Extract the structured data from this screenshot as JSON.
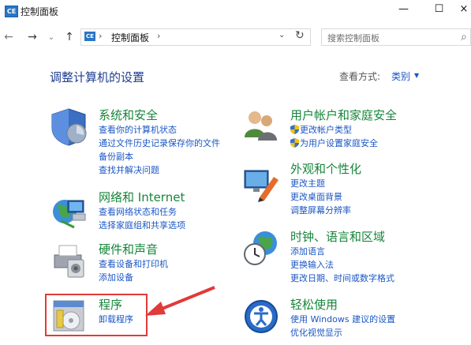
{
  "window": {
    "title": "控制面板",
    "app_icon_text": "CE",
    "minimize": "—",
    "maximize": "☐",
    "close": "×"
  },
  "nav": {
    "back": "←",
    "forward": "→",
    "recent": "⌄",
    "up": "↑"
  },
  "address": {
    "icon_text": "CE",
    "path": "控制面板",
    "separator": "›",
    "dropdown": "⌄",
    "refresh": "↻"
  },
  "search": {
    "placeholder": "搜索控制面板",
    "icon": "search-icon"
  },
  "page": {
    "title": "调整计算机的设置",
    "view_by_label": "查看方式:",
    "view_by_value": "类别"
  },
  "categories": [
    {
      "title": "系统和安全",
      "icon": "shield-icon",
      "links": [
        "查看你的计算机状态",
        "通过文件历史记录保存你的文件",
        "备份副本",
        "查找并解决问题"
      ]
    },
    {
      "title": "网络和 Internet",
      "icon": "network-icon",
      "links": [
        "查看网络状态和任务",
        "选择家庭组和共享选项"
      ]
    },
    {
      "title": "硬件和声音",
      "icon": "printer-icon",
      "links": [
        "查看设备和打印机",
        "添加设备"
      ]
    },
    {
      "title": "程序",
      "icon": "programs-icon",
      "links": [
        "卸载程序"
      ]
    },
    {
      "title": "用户帐户和家庭安全",
      "icon": "users-icon",
      "links": [
        "更改帐户类型",
        "为用户设置家庭安全"
      ]
    },
    {
      "title": "外观和个性化",
      "icon": "appearance-icon",
      "links": [
        "更改主题",
        "更改桌面背景",
        "调整屏幕分辨率"
      ]
    },
    {
      "title": "时钟、语言和区域",
      "icon": "clock-globe-icon",
      "links": [
        "添加语言",
        "更换输入法",
        "更改日期、时间或数字格式"
      ]
    },
    {
      "title": "轻松使用",
      "icon": "ease-of-access-icon",
      "links": [
        "使用 Windows 建议的设置",
        "优化视觉显示"
      ]
    }
  ],
  "annotation": {
    "highlight_color": "#e13a3a"
  }
}
